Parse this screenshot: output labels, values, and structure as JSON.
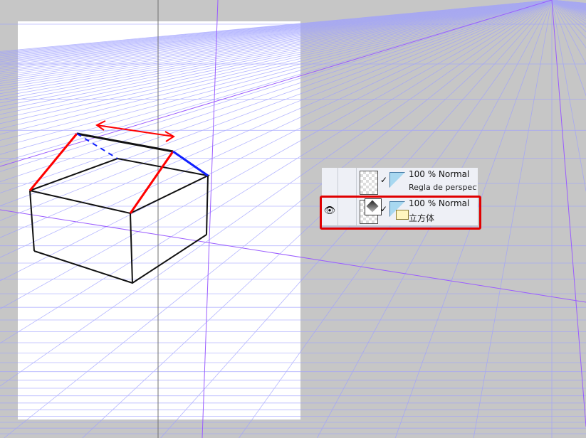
{
  "layers": [
    {
      "opacity_mode": "100 % Normal",
      "name": "Regla de perspectiva",
      "visible": false,
      "selected": false
    },
    {
      "opacity_mode": "100 % Normal",
      "name": "立方体",
      "visible": true,
      "selected": true
    }
  ],
  "icons": {
    "eye": "eye-icon",
    "check": "✓"
  },
  "colors": {
    "highlight": "#e00000",
    "grid": "#8c8cff",
    "guide": "#9a5cff"
  }
}
